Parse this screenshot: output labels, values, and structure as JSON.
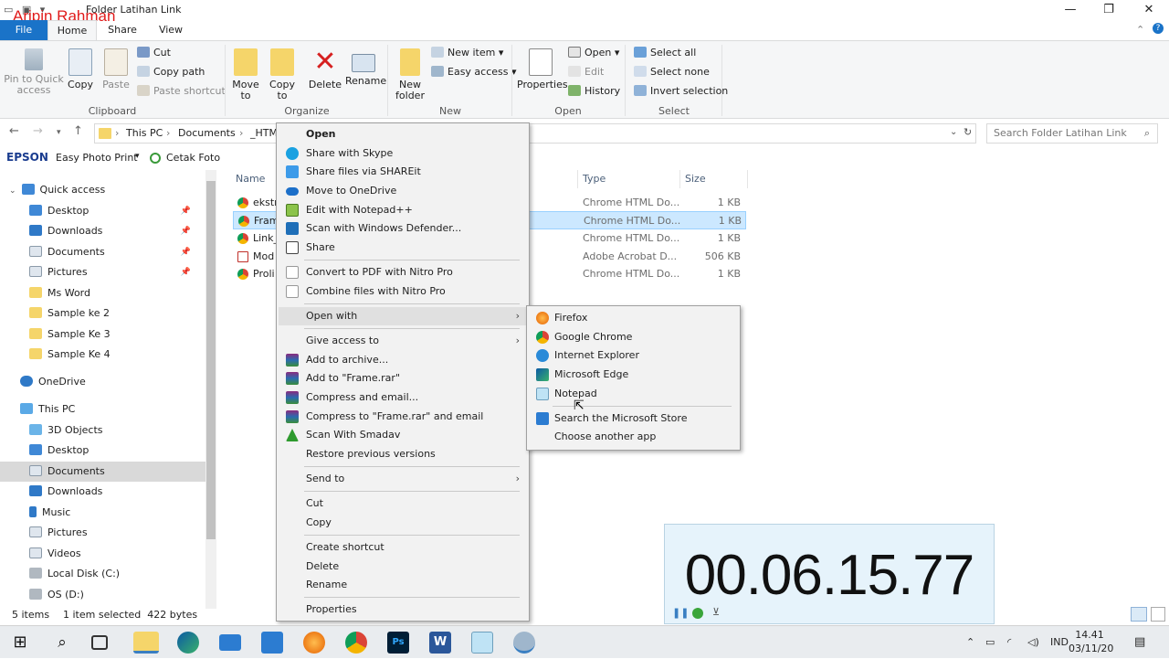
{
  "window": {
    "title": "Folder Latihan Link",
    "watermark": "Aripin Rahman",
    "minimize": "—",
    "maximize": "❐",
    "close": "✕"
  },
  "tabs": {
    "file": "File",
    "home": "Home",
    "share": "Share",
    "view": "View"
  },
  "ribbon": {
    "clipboard": {
      "group": "Clipboard",
      "pin": "Pin to Quick access",
      "copy": "Copy",
      "paste": "Paste",
      "cut": "Cut",
      "copy_path": "Copy path",
      "paste_shortcut": "Paste shortcut"
    },
    "organize": {
      "group": "Organize",
      "move_to": "Move to",
      "copy_to": "Copy to",
      "delete": "Delete",
      "rename": "Rename"
    },
    "new": {
      "group": "New",
      "new_folder": "New folder",
      "new_item": "New item",
      "easy_access": "Easy access"
    },
    "open": {
      "group": "Open",
      "properties": "Properties",
      "open": "Open",
      "edit": "Edit",
      "history": "History"
    },
    "select": {
      "group": "Select",
      "select_all": "Select all",
      "select_none": "Select none",
      "invert": "Invert selection"
    }
  },
  "address": {
    "crumbs": [
      "This PC",
      "Documents",
      "_HTM"
    ],
    "search_placeholder": "Search Folder Latihan Link"
  },
  "epson": {
    "brand": "EPSON",
    "easy_photo_print": "Easy Photo Print",
    "cetak_foto": "Cetak Foto"
  },
  "sidebar": {
    "quick_access": "Quick access",
    "quick_items": [
      "Desktop",
      "Downloads",
      "Documents",
      "Pictures",
      "Ms Word",
      "Sample ke 2",
      "Sample Ke 3",
      "Sample Ke 4"
    ],
    "onedrive": "OneDrive",
    "this_pc": "This PC",
    "pc_items": [
      "3D Objects",
      "Desktop",
      "Documents",
      "Downloads",
      "Music",
      "Pictures",
      "Videos",
      "Local Disk (C:)",
      "OS (D:)"
    ]
  },
  "columns": {
    "name": "Name",
    "type": "Type",
    "size": "Size"
  },
  "files": [
    {
      "name": "ekstr",
      "type": "Chrome HTML Do...",
      "size": "1 KB",
      "icon": "chrome-icon"
    },
    {
      "name": "Fram",
      "type": "Chrome HTML Do...",
      "size": "1 KB",
      "icon": "chrome-icon"
    },
    {
      "name": "Link_",
      "type": "Chrome HTML Do...",
      "size": "1 KB",
      "icon": "chrome-icon"
    },
    {
      "name": "Mod",
      "type": "Adobe Acrobat D...",
      "size": "506 KB",
      "icon": "pdf-icon"
    },
    {
      "name": "Proli",
      "type": "Chrome HTML Do...",
      "size": "1 KB",
      "icon": "chrome-icon"
    }
  ],
  "status": {
    "count": "5 items",
    "selected": "1 item selected  422 bytes"
  },
  "context_menu": [
    "Open",
    "Share with Skype",
    "Share files via SHAREit",
    "Move to OneDrive",
    "Edit with Notepad++",
    "Scan with Windows Defender...",
    "Share",
    "Convert to PDF with Nitro Pro",
    "Combine files with Nitro Pro",
    "Open with",
    "Give access to",
    "Add to archive...",
    "Add to \"Frame.rar\"",
    "Compress and email...",
    "Compress to \"Frame.rar\" and email",
    "Scan With Smadav",
    "Restore previous versions",
    "Send to",
    "Cut",
    "Copy",
    "Create shortcut",
    "Delete",
    "Rename",
    "Properties"
  ],
  "open_with": [
    "Firefox",
    "Google Chrome",
    "Internet Explorer",
    "Microsoft Edge",
    "Notepad",
    "Search the Microsoft Store",
    "Choose another app"
  ],
  "timer": {
    "value": "00.06.15.77"
  },
  "taskbar": {
    "lang": "IND",
    "time": "14.41",
    "date": "03/11/20"
  }
}
